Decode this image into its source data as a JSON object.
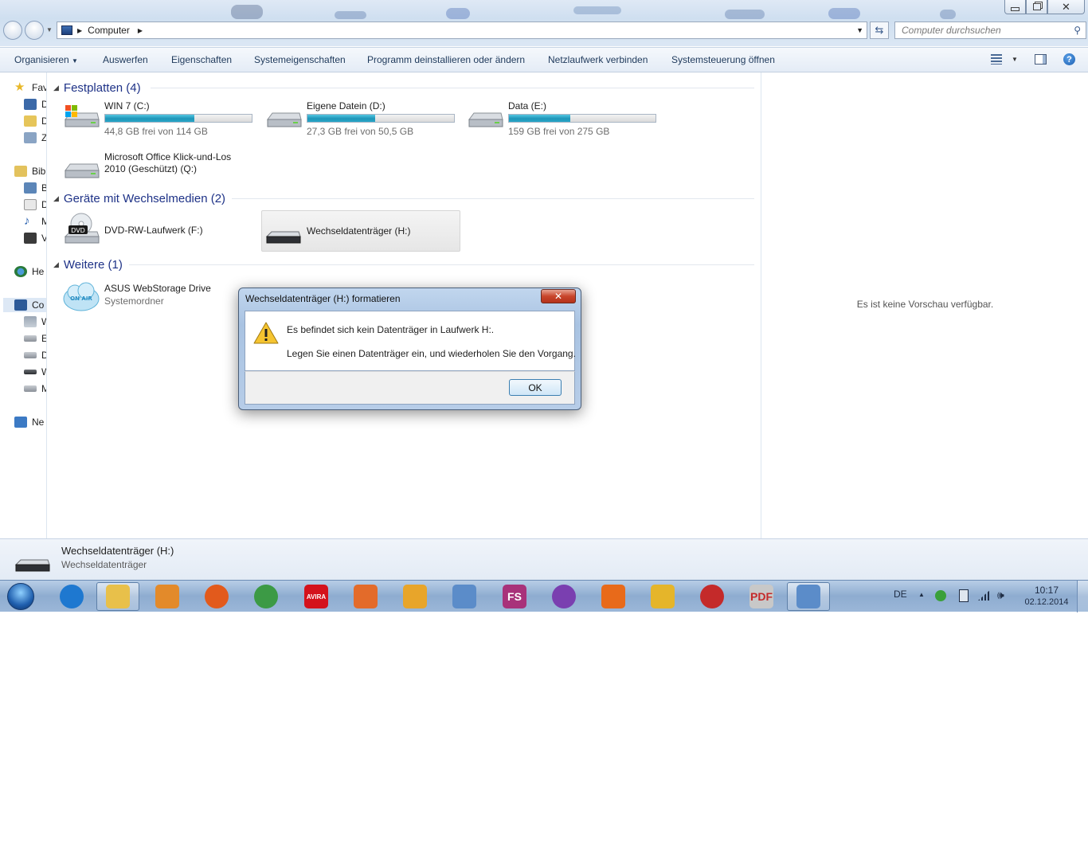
{
  "window": {
    "breadcrumb": [
      "Computer"
    ],
    "search_placeholder": "Computer durchsuchen",
    "caption_buttons": [
      "minimize",
      "restore",
      "close"
    ]
  },
  "command_bar": {
    "items": [
      "Organisieren",
      "Auswerfen",
      "Eigenschaften",
      "Systemeigenschaften",
      "Programm deinstallieren oder ändern",
      "Netzlaufwerk verbinden",
      "Systemsteuerung öffnen"
    ]
  },
  "nav_pane": {
    "items": [
      {
        "label": "Fav",
        "icon": "star-icon"
      },
      {
        "label": "D",
        "icon": "desktop-icon"
      },
      {
        "label": "D",
        "icon": "downloads-icon"
      },
      {
        "label": "Z",
        "icon": "recent-places-icon"
      },
      {
        "label": "Bib",
        "icon": "libraries-icon"
      },
      {
        "label": "B",
        "icon": "pictures-icon"
      },
      {
        "label": "D",
        "icon": "documents-icon"
      },
      {
        "label": "M",
        "icon": "music-icon"
      },
      {
        "label": "V",
        "icon": "videos-icon"
      },
      {
        "label": "He",
        "icon": "homegroup-icon"
      },
      {
        "label": "Co",
        "icon": "computer-icon"
      },
      {
        "label": "W",
        "icon": "windows-drive-icon"
      },
      {
        "label": "E",
        "icon": "drive-icon"
      },
      {
        "label": "D",
        "icon": "drive-icon"
      },
      {
        "label": "W",
        "icon": "removable-drive-icon"
      },
      {
        "label": "M",
        "icon": "drive-icon"
      },
      {
        "label": "Ne",
        "icon": "network-icon"
      }
    ]
  },
  "groups": {
    "hard_disks": {
      "header": "Festplatten (4)",
      "drives": [
        {
          "name": "WIN 7 (C:)",
          "free": "44,8 GB frei von 114 GB",
          "used_fraction": 0.61
        },
        {
          "name": "Eigene Datein (D:)",
          "free": "27,3 GB frei von 50,5 GB",
          "used_fraction": 0.46
        },
        {
          "name": "Data (E:)",
          "free": "159 GB frei von 275 GB",
          "used_fraction": 0.42
        },
        {
          "name_line1": "Microsoft Office Klick-und-Los",
          "name_line2": "2010 (Geschützt) (Q:)"
        }
      ]
    },
    "removable": {
      "header": "Geräte mit Wechselmedien (2)",
      "drives": [
        {
          "name": "DVD-RW-Laufwerk (F:)",
          "badge": "DVD"
        },
        {
          "name": "Wechseldatenträger (H:)"
        }
      ]
    },
    "other": {
      "header": "Weitere (1)",
      "items": [
        {
          "name": "ASUS WebStorage Drive",
          "subtitle": "Systemordner",
          "badge": "ON AIR"
        }
      ]
    }
  },
  "preview": {
    "text": "Es ist keine Vorschau verfügbar."
  },
  "details": {
    "title": "Wechseldatenträger (H:)",
    "subtitle": "Wechseldatenträger"
  },
  "dialog": {
    "title": "Wechseldatenträger (H:) formatieren",
    "message_line1": "Es befindet sich kein Datenträger in Laufwerk H:.",
    "message_line2": "Legen Sie einen Datenträger ein, und wiederholen Sie den Vorgang.",
    "ok_label": "OK",
    "close_label": "✕"
  },
  "taskbar": {
    "apps": [
      {
        "name": "internet-explorer",
        "color": "#1e78d0"
      },
      {
        "name": "windows-explorer",
        "color": "#e8c04a"
      },
      {
        "name": "media-player",
        "color": "#e38a2a"
      },
      {
        "name": "firefox",
        "color": "#e25a1c"
      },
      {
        "name": "chrome",
        "color": "#3c9a45"
      },
      {
        "name": "avira",
        "color": "#d4121c",
        "label": "AVIRA"
      },
      {
        "name": "app-flame",
        "color": "#e36b2a"
      },
      {
        "name": "outlook",
        "color": "#e8a52a"
      },
      {
        "name": "window-app",
        "color": "#5b8cc9"
      },
      {
        "name": "fs-app",
        "color": "#a8327a",
        "label": "FS"
      },
      {
        "name": "yahoo-messenger",
        "color": "#7a3fb0"
      },
      {
        "name": "bookmark-app",
        "color": "#e86a1a"
      },
      {
        "name": "game-app",
        "color": "#e5b52a"
      },
      {
        "name": "download-app",
        "color": "#c42a2a"
      },
      {
        "name": "pdf-app",
        "color": "#c8c8c8",
        "label": "PDF"
      },
      {
        "name": "remote-desktop",
        "color": "#5b8cc9"
      }
    ],
    "language": "DE",
    "time": "10:17",
    "date": "02.12.2014"
  }
}
